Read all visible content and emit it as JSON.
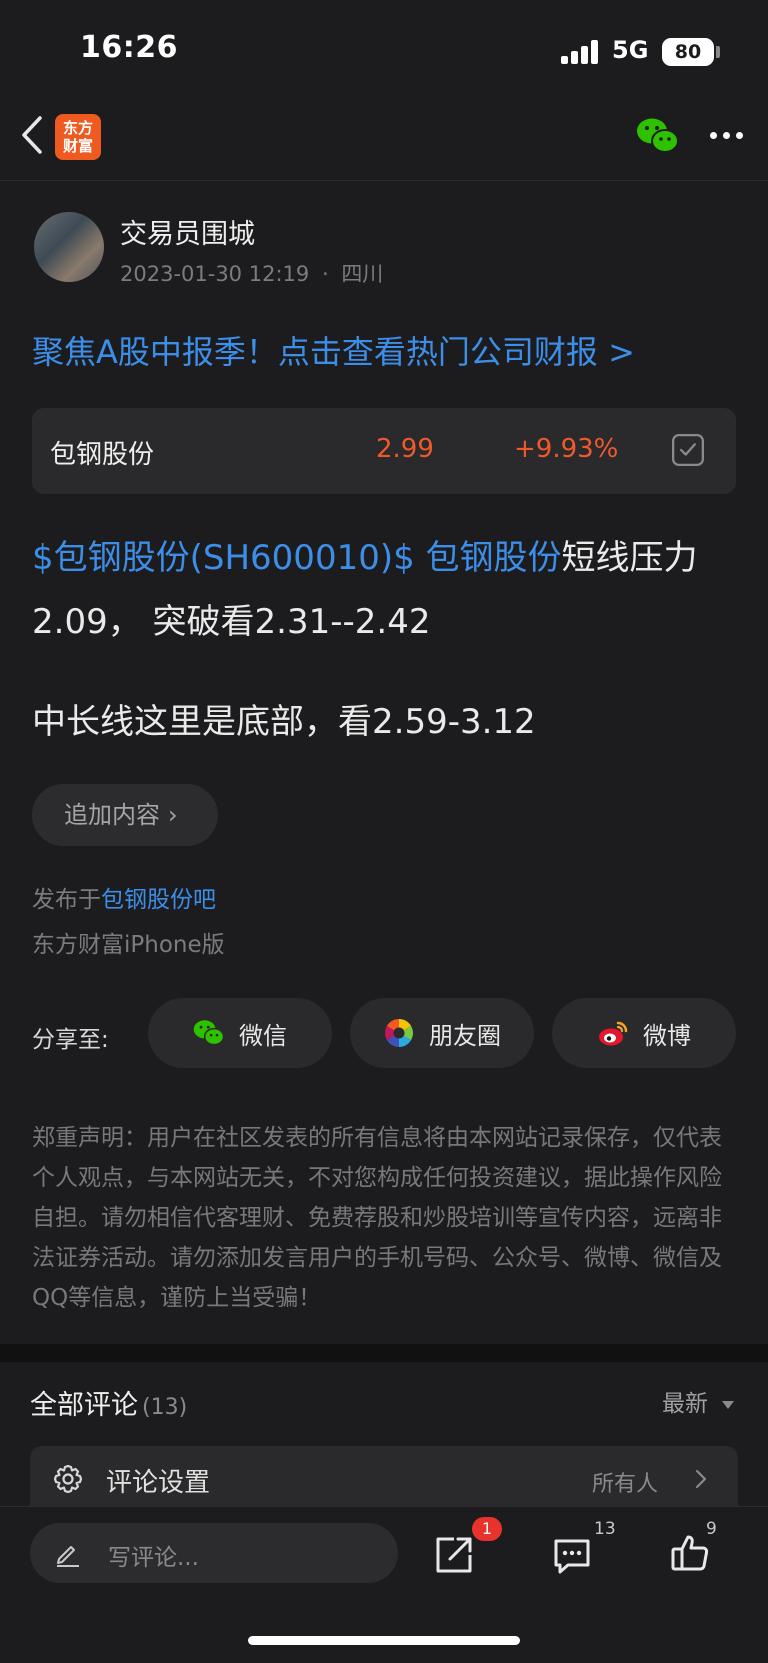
{
  "status": {
    "time": "16:26",
    "network": "5G",
    "battery": "80"
  },
  "nav": {
    "logo_text": "东方财富"
  },
  "post": {
    "author": "交易员围城",
    "date": "2023-01-30 12:19",
    "separator": "·",
    "location": "四川",
    "promo": "聚焦A股中报季！点击查看热门公司财报 >",
    "stock": {
      "name": "包钢股份",
      "price": "2.99",
      "change": "+9.93%"
    },
    "body_link1": "$包钢股份(SH600010)$",
    "body_link2": "包钢股份",
    "body_text1": "短线压力2.09， 突破看2.31--2.42",
    "body_p2": "中长线这里是底部，看2.59-3.12",
    "append_label": "追加内容",
    "posted_prefix": "发布于",
    "posted_bar": "包钢股份吧",
    "device": "东方财富iPhone版"
  },
  "share": {
    "label": "分享至:",
    "buttons": [
      {
        "label": "微信",
        "icon": "wechat-icon"
      },
      {
        "label": "朋友圈",
        "icon": "moments-icon"
      },
      {
        "label": "微博",
        "icon": "weibo-icon"
      }
    ]
  },
  "disclaimer": "郑重声明：用户在社区发表的所有信息将由本网站记录保存，仅代表个人观点，与本网站无关，不对您构成任何投资建议，据此操作风险自担。请勿相信代客理财、免费荐股和炒股培训等宣传内容，远离非法证券活动。请勿添加发言用户的手机号码、公众号、微博、微信及QQ等信息，谨防上当受骗！",
  "comments": {
    "title": "全部评论",
    "count": "(13)",
    "sort": "最新",
    "settings_label": "评论设置",
    "settings_value": "所有人"
  },
  "bottom": {
    "placeholder": "写评论...",
    "share_badge": "1",
    "comment_count": "13",
    "like_count": "9"
  },
  "colors": {
    "accent_blue": "#3c8ee8",
    "rise_red": "#f0592b",
    "brand_orange": "#ee5a1f"
  }
}
